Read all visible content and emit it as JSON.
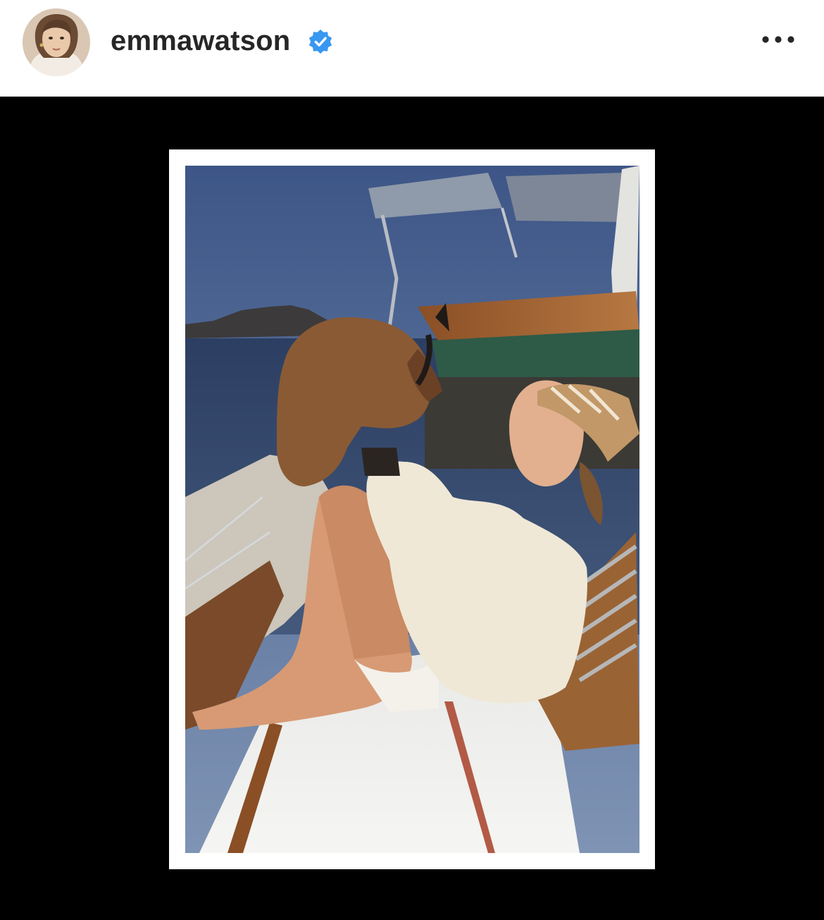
{
  "post": {
    "username": "emmawatson",
    "verified": true,
    "avatar_alt": "avatar",
    "more_icon": "more-horizontal-icon",
    "verified_icon": "verified-badge-icon"
  },
  "colors": {
    "background": "#ffffff",
    "username_text": "#262626",
    "verified_blue": "#3897f0",
    "media_background": "#000000",
    "photo_border": "#ffffff"
  },
  "media": {
    "type": "photo",
    "subject": "photo print"
  }
}
